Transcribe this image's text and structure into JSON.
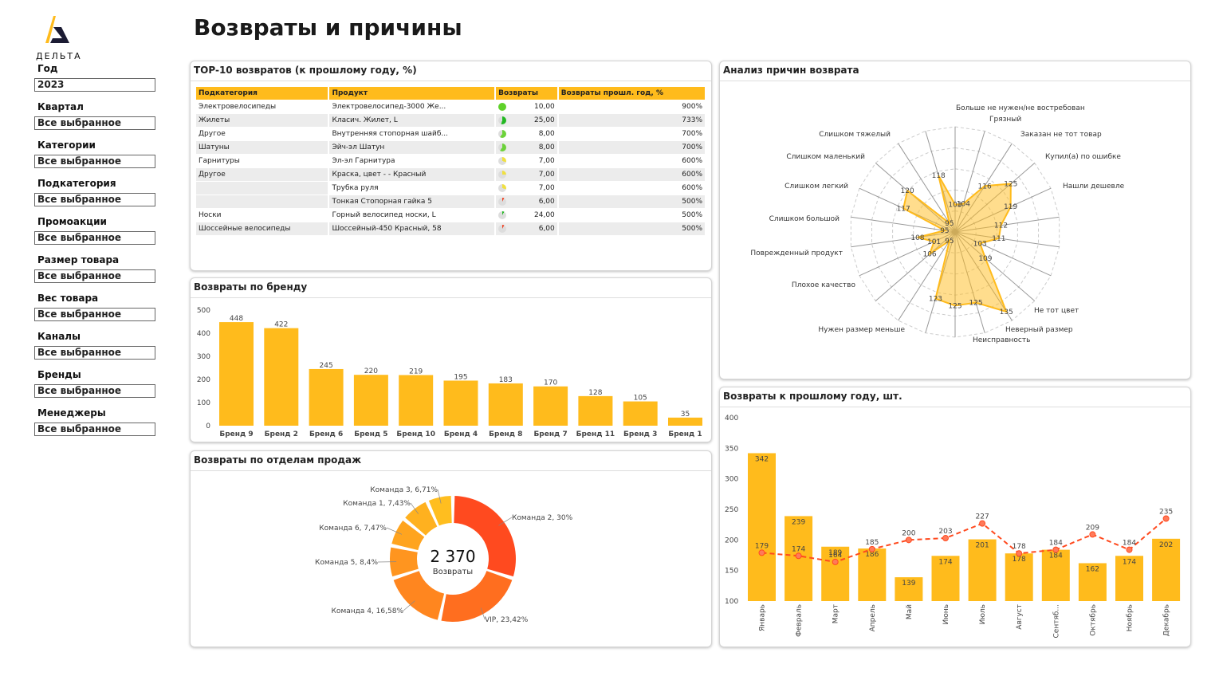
{
  "page_title": "Возвраты и причины",
  "logo": {
    "text": "ДЕЛЬТА"
  },
  "filters": [
    {
      "label": "Год",
      "value": "2023"
    },
    {
      "label": "Квартал",
      "value": "Все выбранное"
    },
    {
      "label": "Категории",
      "value": "Все выбранное"
    },
    {
      "label": "Подкатегория",
      "value": "Все выбранное"
    },
    {
      "label": "Промоакции",
      "value": "Все выбранное"
    },
    {
      "label": "Размер товара",
      "value": "Все выбранное"
    },
    {
      "label": "Вес товара",
      "value": "Все выбранное"
    },
    {
      "label": "Каналы",
      "value": "Все выбранное"
    },
    {
      "label": "Бренды",
      "value": "Все выбранное"
    },
    {
      "label": "Менеджеры",
      "value": "Все выбранное"
    }
  ],
  "top10": {
    "title": "TOP-10 возвратов (к прошлому году, %)",
    "columns": [
      "Подкатегория",
      "Продукт",
      "Возвраты",
      "Возвраты прошл. год, %"
    ],
    "rows": [
      {
        "sub": "Электровелосипеды",
        "product": "Электровелосипед-3000 Же...",
        "returns": "10,00",
        "pct": "900%",
        "kpi": 1.0,
        "kpi_color": "#5fd12a"
      },
      {
        "sub": "Жилеты",
        "product": "Класич. Жилет, L",
        "returns": "25,00",
        "pct": "733%",
        "kpi": 0.55,
        "kpi_color": "#22b822"
      },
      {
        "sub": "Другое",
        "product": "Внутренняя стопорная шайб...",
        "returns": "8,00",
        "pct": "700%",
        "kpi": 0.6,
        "kpi_color": "#6cd23a"
      },
      {
        "sub": "Шатуны",
        "product": "Эйч-эл Шатун",
        "returns": "8,00",
        "pct": "700%",
        "kpi": 0.6,
        "kpi_color": "#6cd23a"
      },
      {
        "sub": "Гарнитуры",
        "product": "Эл-эл Гарнитура",
        "returns": "7,00",
        "pct": "600%",
        "kpi": 0.3,
        "kpi_color": "#f0e040"
      },
      {
        "sub": "Другое",
        "product": "Краска, цвет - - Красный",
        "returns": "7,00",
        "pct": "600%",
        "kpi": 0.25,
        "kpi_color": "#f0e040"
      },
      {
        "sub": "",
        "product": "Трубка руля",
        "returns": "7,00",
        "pct": "600%",
        "kpi": 0.3,
        "kpi_color": "#f0e040"
      },
      {
        "sub": "",
        "product": "Тонкая Стопорная гайка 5",
        "returns": "6,00",
        "pct": "500%",
        "kpi": 0.08,
        "kpi_color": "#f04020"
      },
      {
        "sub": "Носки",
        "product": "Горный велосипед носки, L",
        "returns": "24,00",
        "pct": "500%",
        "kpi": 0.08,
        "kpi_color": "#22b822"
      },
      {
        "sub": "Шоссейные велосипеды",
        "product": "Шоссейный-450 Красный, 58",
        "returns": "6,00",
        "pct": "500%",
        "kpi": 0.08,
        "kpi_color": "#f04020"
      }
    ]
  },
  "chart_data": [
    {
      "type": "bar",
      "title": "Возвраты по бренду",
      "categories": [
        "Бренд 9",
        "Бренд 2",
        "Бренд 6",
        "Бренд 5",
        "Бренд 10",
        "Бренд 4",
        "Бренд 8",
        "Бренд 7",
        "Бренд 11",
        "Бренд 3",
        "Бренд 1"
      ],
      "values": [
        448,
        422,
        245,
        220,
        219,
        195,
        183,
        170,
        128,
        105,
        35
      ],
      "ylim": [
        0,
        500
      ],
      "yticks": [
        0,
        100,
        200,
        300,
        400,
        500
      ],
      "color": "#FFBB1C"
    },
    {
      "type": "pie",
      "title": "Возвраты по отделам продаж",
      "center_value": "2 370",
      "center_label": "Возвраты",
      "slices": [
        {
          "label": "Команда 2, 30%",
          "value": 30,
          "color": "#FF4A1F"
        },
        {
          "label": "VIP, 23,42%",
          "value": 23.42,
          "color": "#FF6E1F"
        },
        {
          "label": "Команда 4, 16,58%",
          "value": 16.58,
          "color": "#FF861F"
        },
        {
          "label": "Команда 5, 8,4%",
          "value": 8.4,
          "color": "#FF951F"
        },
        {
          "label": "Команда 6, 7,47%",
          "value": 7.47,
          "color": "#FFA41F"
        },
        {
          "label": "Команда 1, 7,43%",
          "value": 7.43,
          "color": "#FFB11F"
        },
        {
          "label": "Команда 3, 6,71%",
          "value": 6.71,
          "color": "#FFBE1F"
        }
      ]
    },
    {
      "type": "radar",
      "title": "Анализ причин возврата",
      "values": [
        103,
        104,
        116,
        125,
        119,
        112,
        111,
        103,
        109,
        135,
        125,
        125,
        123,
        95,
        106,
        101,
        108,
        95,
        117,
        120,
        95,
        118
      ],
      "labels": [
        "Больше не нужен/не востребован",
        "Грязный",
        "Заказан не тот товар",
        "Купил(а) по ошибке",
        "Нашли дешевле",
        "Не тот цвет",
        "Неверный размер",
        "Неисправность",
        "Нужен размер меньше",
        "Плохое качество",
        "Поврежденный продукт",
        "Слишком большой",
        "Слишком легкий",
        "Слишком маленький",
        "Слишком тяжелый"
      ],
      "color": "#FFBB1C"
    },
    {
      "type": "bar+line",
      "title": "Возвраты к прошлому году, шт.",
      "categories": [
        "Январь",
        "Февраль",
        "Март",
        "Апрель",
        "Май",
        "Июнь",
        "Июль",
        "Август",
        "Сентяб...",
        "Октябрь",
        "Ноябрь",
        "Декабрь"
      ],
      "series": [
        {
          "type": "bar",
          "values": [
            342,
            239,
            189,
            186,
            139,
            174,
            201,
            178,
            184,
            162,
            174,
            202
          ],
          "color": "#FFBB1C"
        },
        {
          "type": "line",
          "values": [
            179,
            174,
            164,
            185,
            200,
            203,
            227,
            178,
            184,
            209,
            184,
            235
          ],
          "color": "#FF4A1F"
        }
      ],
      "ylim": [
        100,
        400
      ],
      "yticks": [
        100,
        150,
        200,
        250,
        300,
        350,
        400
      ]
    }
  ]
}
